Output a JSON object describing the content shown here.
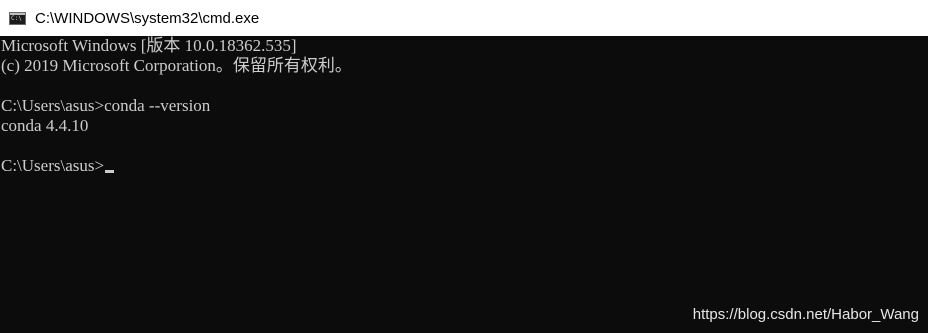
{
  "window": {
    "title": "C:\\WINDOWS\\system32\\cmd.exe",
    "icon": "cmd-console-icon"
  },
  "console": {
    "lines": [
      "Microsoft Windows [版本 10.0.18362.535]",
      "(c) 2019 Microsoft Corporation。保留所有权利。",
      "",
      "C:\\Users\\asus>conda --version",
      "conda 4.4.10",
      "",
      "C:\\Users\\asus>"
    ]
  },
  "watermark": "https://blog.csdn.net/Habor_Wang",
  "colors": {
    "background": "#0c0c0c",
    "foreground": "#cccccc",
    "titlebar": "#ffffff"
  }
}
